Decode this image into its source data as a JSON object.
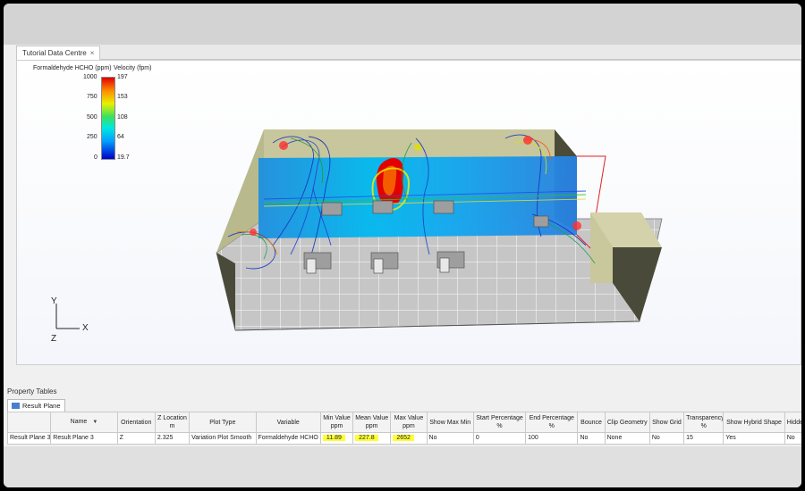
{
  "document_tab": {
    "label": "Tutorial Data Centre",
    "close_glyph": "×"
  },
  "legend": {
    "left_title": "Formaldehyde HCHO (ppm)",
    "right_title": "Velocity (fpm)",
    "left_ticks": [
      "1000",
      "750",
      "500",
      "250",
      "0"
    ],
    "right_ticks": [
      "197",
      "153",
      "108",
      "64",
      "19.7"
    ]
  },
  "axes": {
    "y": "Y",
    "x": "X",
    "z": "Z"
  },
  "property_tables": {
    "label": "Property Tables",
    "tab_label": "Result Plane",
    "tab_icon": "plane-icon",
    "columns": [
      "",
      "Name",
      "Orientation",
      "Z Location m",
      "Plot Type",
      "Variable",
      "Min Value ppm",
      "Mean Value ppm",
      "Max Value ppm",
      "Show Max Min",
      "Start Percentage %",
      "End Percentage %",
      "Bounce",
      "Clip Geometry",
      "Show Grid",
      "Transparency %",
      "Show Hybrid Shape",
      "Hidden"
    ],
    "row": [
      "Result Plane 3",
      "Result Plane 3",
      "Z",
      "2.325",
      "Variation Plot Smooth",
      "Formaldehyde HCHO",
      "11.89",
      "227.8",
      "2652",
      "No",
      "0",
      "100",
      "No",
      "None",
      "No",
      "15",
      "Yes",
      "No"
    ],
    "highlight_color": "#ffff33"
  }
}
